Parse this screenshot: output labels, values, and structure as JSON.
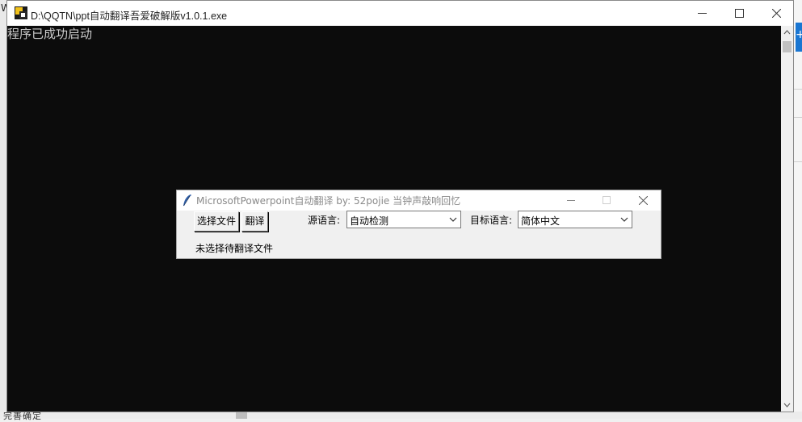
{
  "background_window": {
    "left_letter": "W",
    "bottom_text": "完善确定",
    "right_plus": "+"
  },
  "console": {
    "title": "D:\\QQTN\\ppt自动翻译吾爱破解版v1.0.1.exe",
    "output_line": "程序已成功启动"
  },
  "app": {
    "title": "MicrosoftPowerpoint自动翻译    by: 52pojie 当钟声敲响回忆",
    "select_file_label": "选择文件",
    "translate_label": "翻译",
    "source_lang_label": "源语言:",
    "source_lang_value": "自动检测",
    "target_lang_label": "目标语言:",
    "target_lang_value": "简体中文",
    "status": "未选择待翻译文件"
  },
  "colors": {
    "console_bg": "#0c0c0c",
    "console_text": "#cccccc",
    "dialog_bg": "#f0f0f0"
  }
}
